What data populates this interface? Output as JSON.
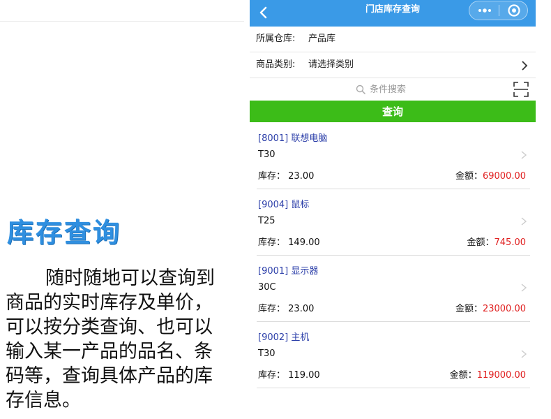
{
  "promo": {
    "title": "库存查询",
    "description": "随时随地可以查询到商品的实时库存及单价，可以按分类查询、也可以输入某一产品的品名、条码等，查询具体产品的库存信息。"
  },
  "app": {
    "nav_title": "门店库存查询",
    "accent_color": "#3a9ae7",
    "button_color": "#3cbc18",
    "amount_color": "#e02020",
    "name_color": "#2a3da8"
  },
  "filters": {
    "warehouse_label": "所属仓库:",
    "warehouse_value": "产品库",
    "category_label": "商品类别:",
    "category_placeholder": "请选择类别"
  },
  "search": {
    "placeholder": "条件搜索",
    "icon": "search-icon",
    "scan_icon": "scan-icon"
  },
  "query_label": "查询",
  "stock_label": "库存：",
  "amount_label": "金额：",
  "items": [
    {
      "name": "[8001] 联想电脑",
      "model": "T30",
      "stock": "23.00",
      "amount": "69000.00"
    },
    {
      "name": "[9004] 鼠标",
      "model": "T25",
      "stock": "149.00",
      "amount": "745.00"
    },
    {
      "name": "[9001] 显示器",
      "model": "30C",
      "stock": "23.00",
      "amount": "23000.00"
    },
    {
      "name": "[9002] 主机",
      "model": "T30",
      "stock": "119.00",
      "amount": "119000.00"
    }
  ]
}
